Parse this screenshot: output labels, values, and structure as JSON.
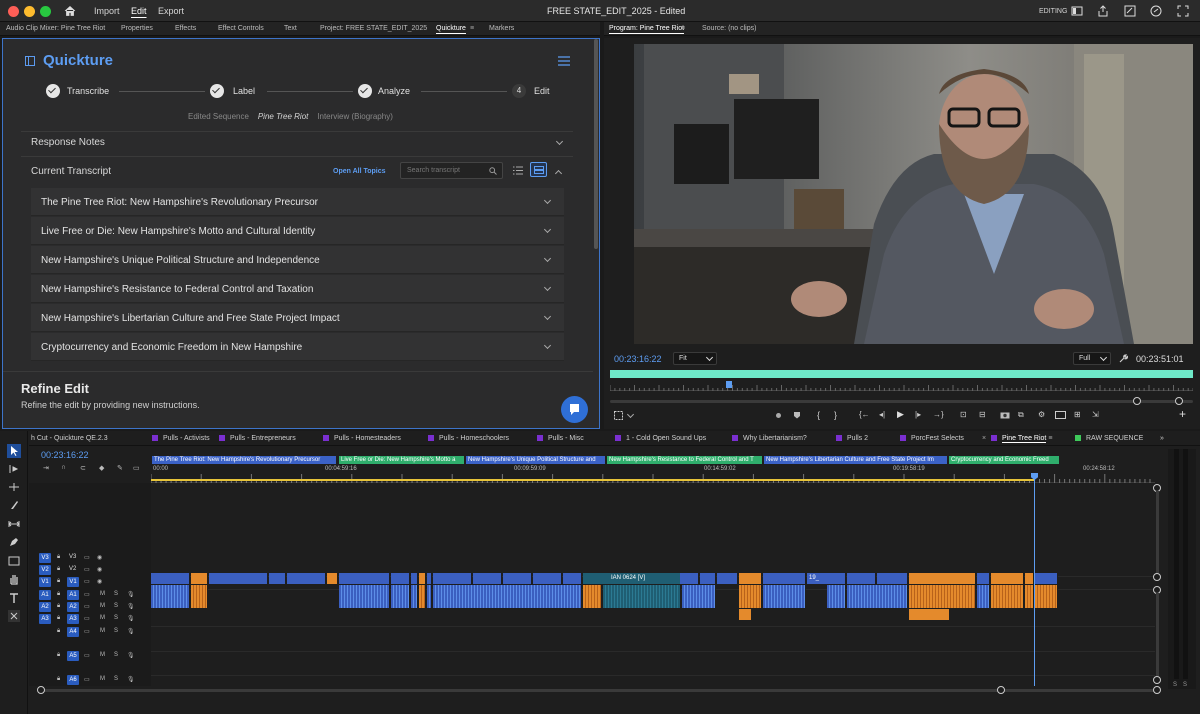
{
  "window": {
    "title": "FREE STATE_EDIT_2025",
    "status": "- Edited",
    "workspace": "EDITING"
  },
  "menu": {
    "import": "Import",
    "edit": "Edit",
    "export": "Export"
  },
  "panel_tabs": [
    "Audio Clip Mixer: Pine Tree Riot",
    "Properties",
    "Effects",
    "Effect Controls",
    "Text",
    "Project: FREE STATE_EDIT_2025",
    "Quickture",
    "Markers"
  ],
  "monitor_tabs": {
    "program": "Program: Pine Tree Riot",
    "source": "Source: (no clips)"
  },
  "quickture": {
    "title": "Quickture",
    "steps": [
      {
        "label": "Transcribe",
        "done": true
      },
      {
        "label": "Label",
        "done": true
      },
      {
        "label": "Analyze",
        "done": true
      },
      {
        "label": "Edit",
        "number": "4"
      }
    ],
    "sequence_label": "Edited Sequence",
    "sequence_name": "Pine Tree Riot",
    "sequence_extra": "Interview (Biography)",
    "response_notes": "Response Notes",
    "current_transcript": "Current Transcript",
    "open_all": "Open All Topics",
    "search_placeholder": "Search transcript",
    "topics": [
      "The Pine Tree Riot: New Hampshire's Revolutionary Precursor",
      "Live Free or Die: New Hampshire's Motto and Cultural Identity",
      "New Hampshire's Unique Political Structure and Independence",
      "New Hampshire's Resistance to Federal Control and Taxation",
      "New Hampshire's Libertarian Culture and Free State Project Impact",
      "Cryptocurrency and Economic Freedom in New Hampshire"
    ],
    "refine_title": "Refine Edit",
    "refine_desc": "Refine the edit by providing new instructions."
  },
  "program": {
    "timecode": "00:23:16:22",
    "fit": "Fit",
    "quality": "Full",
    "duration": "00:23:51:01",
    "accent": "#6ee8c8"
  },
  "timeline": {
    "tabs": [
      {
        "label": "h Cut - Quickture QE.2.3",
        "color": ""
      },
      {
        "label": "Pulls - Activists",
        "color": "#7a2fd0"
      },
      {
        "label": "Pulls - Entrepreneurs",
        "color": "#7a2fd0"
      },
      {
        "label": "Pulls - Homesteaders",
        "color": "#7a2fd0"
      },
      {
        "label": "Pulls - Homeschoolers",
        "color": "#7a2fd0"
      },
      {
        "label": "Pulls - Misc",
        "color": "#7a2fd0"
      },
      {
        "label": "1 - Cold Open Sound Ups",
        "color": "#7a2fd0"
      },
      {
        "label": "Why Libertarianism?",
        "color": "#7a2fd0"
      },
      {
        "label": "Pulls 2",
        "color": "#7a2fd0"
      },
      {
        "label": "PorcFest Selects",
        "color": "#7a2fd0"
      },
      {
        "label": "Pine Tree Riot",
        "color": "#7a2fd0"
      },
      {
        "label": "RAW SEQUENCE",
        "color": "#3ec95a"
      }
    ],
    "timecode": "00:23:16:22",
    "ruler": [
      "00:00",
      "00:04:59:16",
      "00:09:59:09",
      "00:14:59:02",
      "00:19:58:19",
      "00:24:58:12"
    ],
    "markers": [
      "The Pine Tree Riot: New Hampshire's Revolutionary Precursor",
      "Live Free or Die: New Hampshire's Motto a",
      "New Hampshire's Unique Political Structure and",
      "New Hampshire's Resistance to Federal Control and T",
      "New Hampshire's Libertarian Culture and Free State Project Im",
      "Cryptocurrency and Economic Freed"
    ],
    "video_tracks": [
      "V3",
      "V2",
      "V1"
    ],
    "audio_tracks": [
      "A1",
      "A2",
      "A3",
      "A4",
      "A5",
      "A6"
    ],
    "source_tracks": [
      "V1",
      "A1",
      "A2",
      "A3"
    ],
    "clip_label_1": "IAN 0624 [V]",
    "clip_label_2": "19_"
  }
}
